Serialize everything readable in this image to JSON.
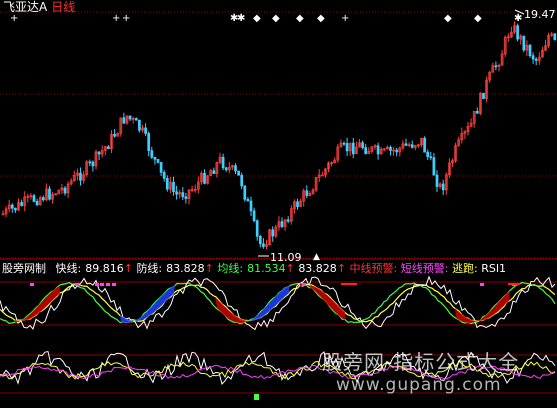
{
  "header": {
    "stock_name": "飞亚达A",
    "period": "日线"
  },
  "price_panel": {
    "high_label": "19.47",
    "low_label": "11.09",
    "colors": {
      "up": "#ff4040",
      "down": "#40d0ff",
      "grid": "#8b0000"
    }
  },
  "indicator_bar": {
    "name": "股旁网制",
    "fast_label": "快线:",
    "fast_value": "89.816",
    "fast_arrow": "↑",
    "defend_label": "防线:",
    "defend_value": "83.828",
    "defend_arrow": "↑",
    "avg_label": "均线:",
    "avg_value": "81.534",
    "avg_arrow": "↑",
    "extra_value": "83.828",
    "extra_arrow": "↑",
    "mid_warn": "中线预警:",
    "short_warn": "短线预警:",
    "escape": "逃跑:",
    "rsi": "RSI1"
  },
  "watermark": {
    "text": "股旁网-指标公式大全",
    "url": "www.gupang.com"
  }
}
